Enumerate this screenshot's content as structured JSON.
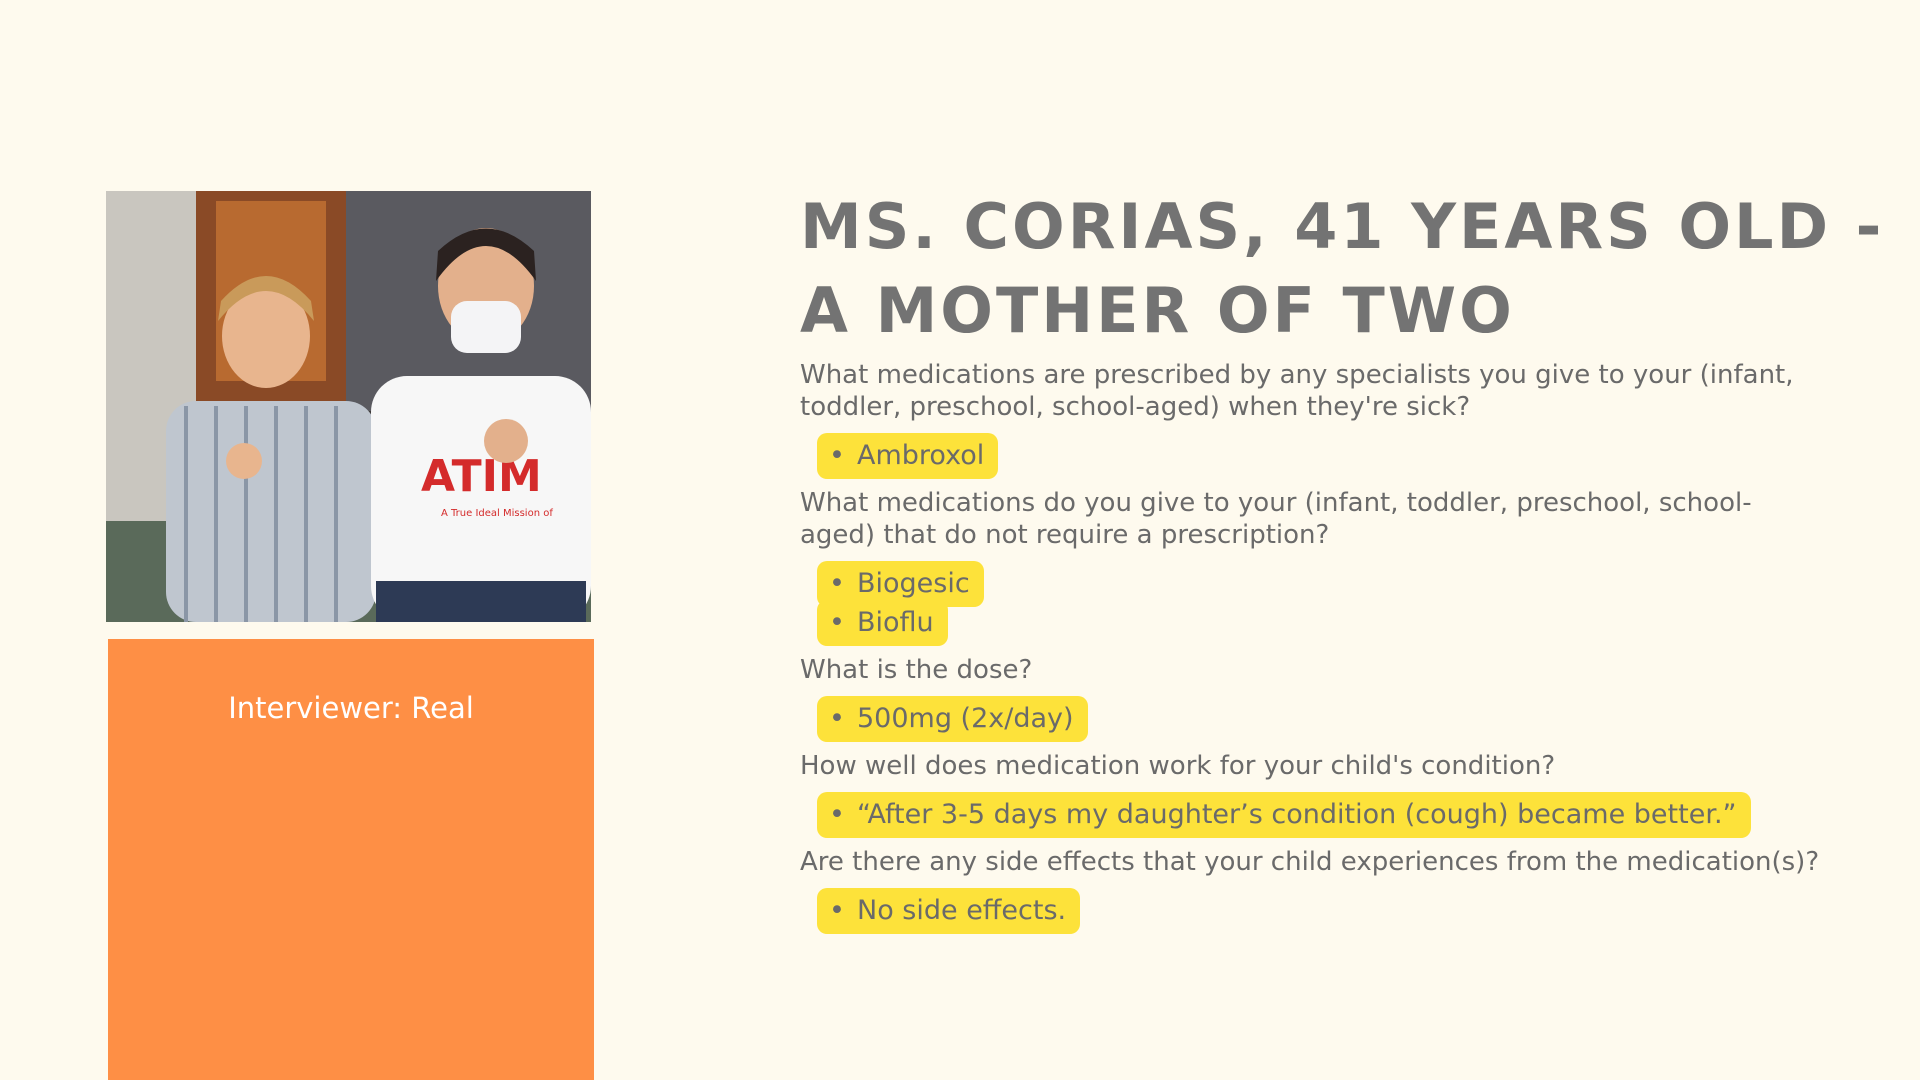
{
  "title_lines": [
    "MS. CORIAS, 41 YEARS OLD -",
    "A MOTHER OF TWO"
  ],
  "photo": {
    "description_icon": "photo-icon",
    "shirt_text": "ATIM",
    "shirt_subtext": "A True Ideal Mission of"
  },
  "caption": "Interviewer: Real",
  "colors": {
    "background": "#fefaee",
    "caption_box": "#fe8f45",
    "highlight": "#fde23a",
    "title": "#737373",
    "text": "#6a6a6a"
  },
  "qa": [
    {
      "question": "What medications are prescribed by any specialists you give to your (infant, toddler, preschool, school-aged) when they're sick?",
      "answers": [
        "Ambroxol"
      ]
    },
    {
      "question": "What medications do you give to your (infant, toddler, preschool, school-aged) that do not require a prescription?",
      "answers": [
        "Biogesic",
        "Bioflu"
      ]
    },
    {
      "question": "What is the dose?",
      "answers": [
        "500mg (2x/day)"
      ]
    },
    {
      "question": "How well does medication work for your child's condition?",
      "answers": [
        "“After 3-5 days my daughter’s condition (cough) became better.”"
      ]
    },
    {
      "question": "Are there any side effects that your child experiences from the medication(s)?",
      "answers": [
        "No side effects."
      ]
    }
  ]
}
